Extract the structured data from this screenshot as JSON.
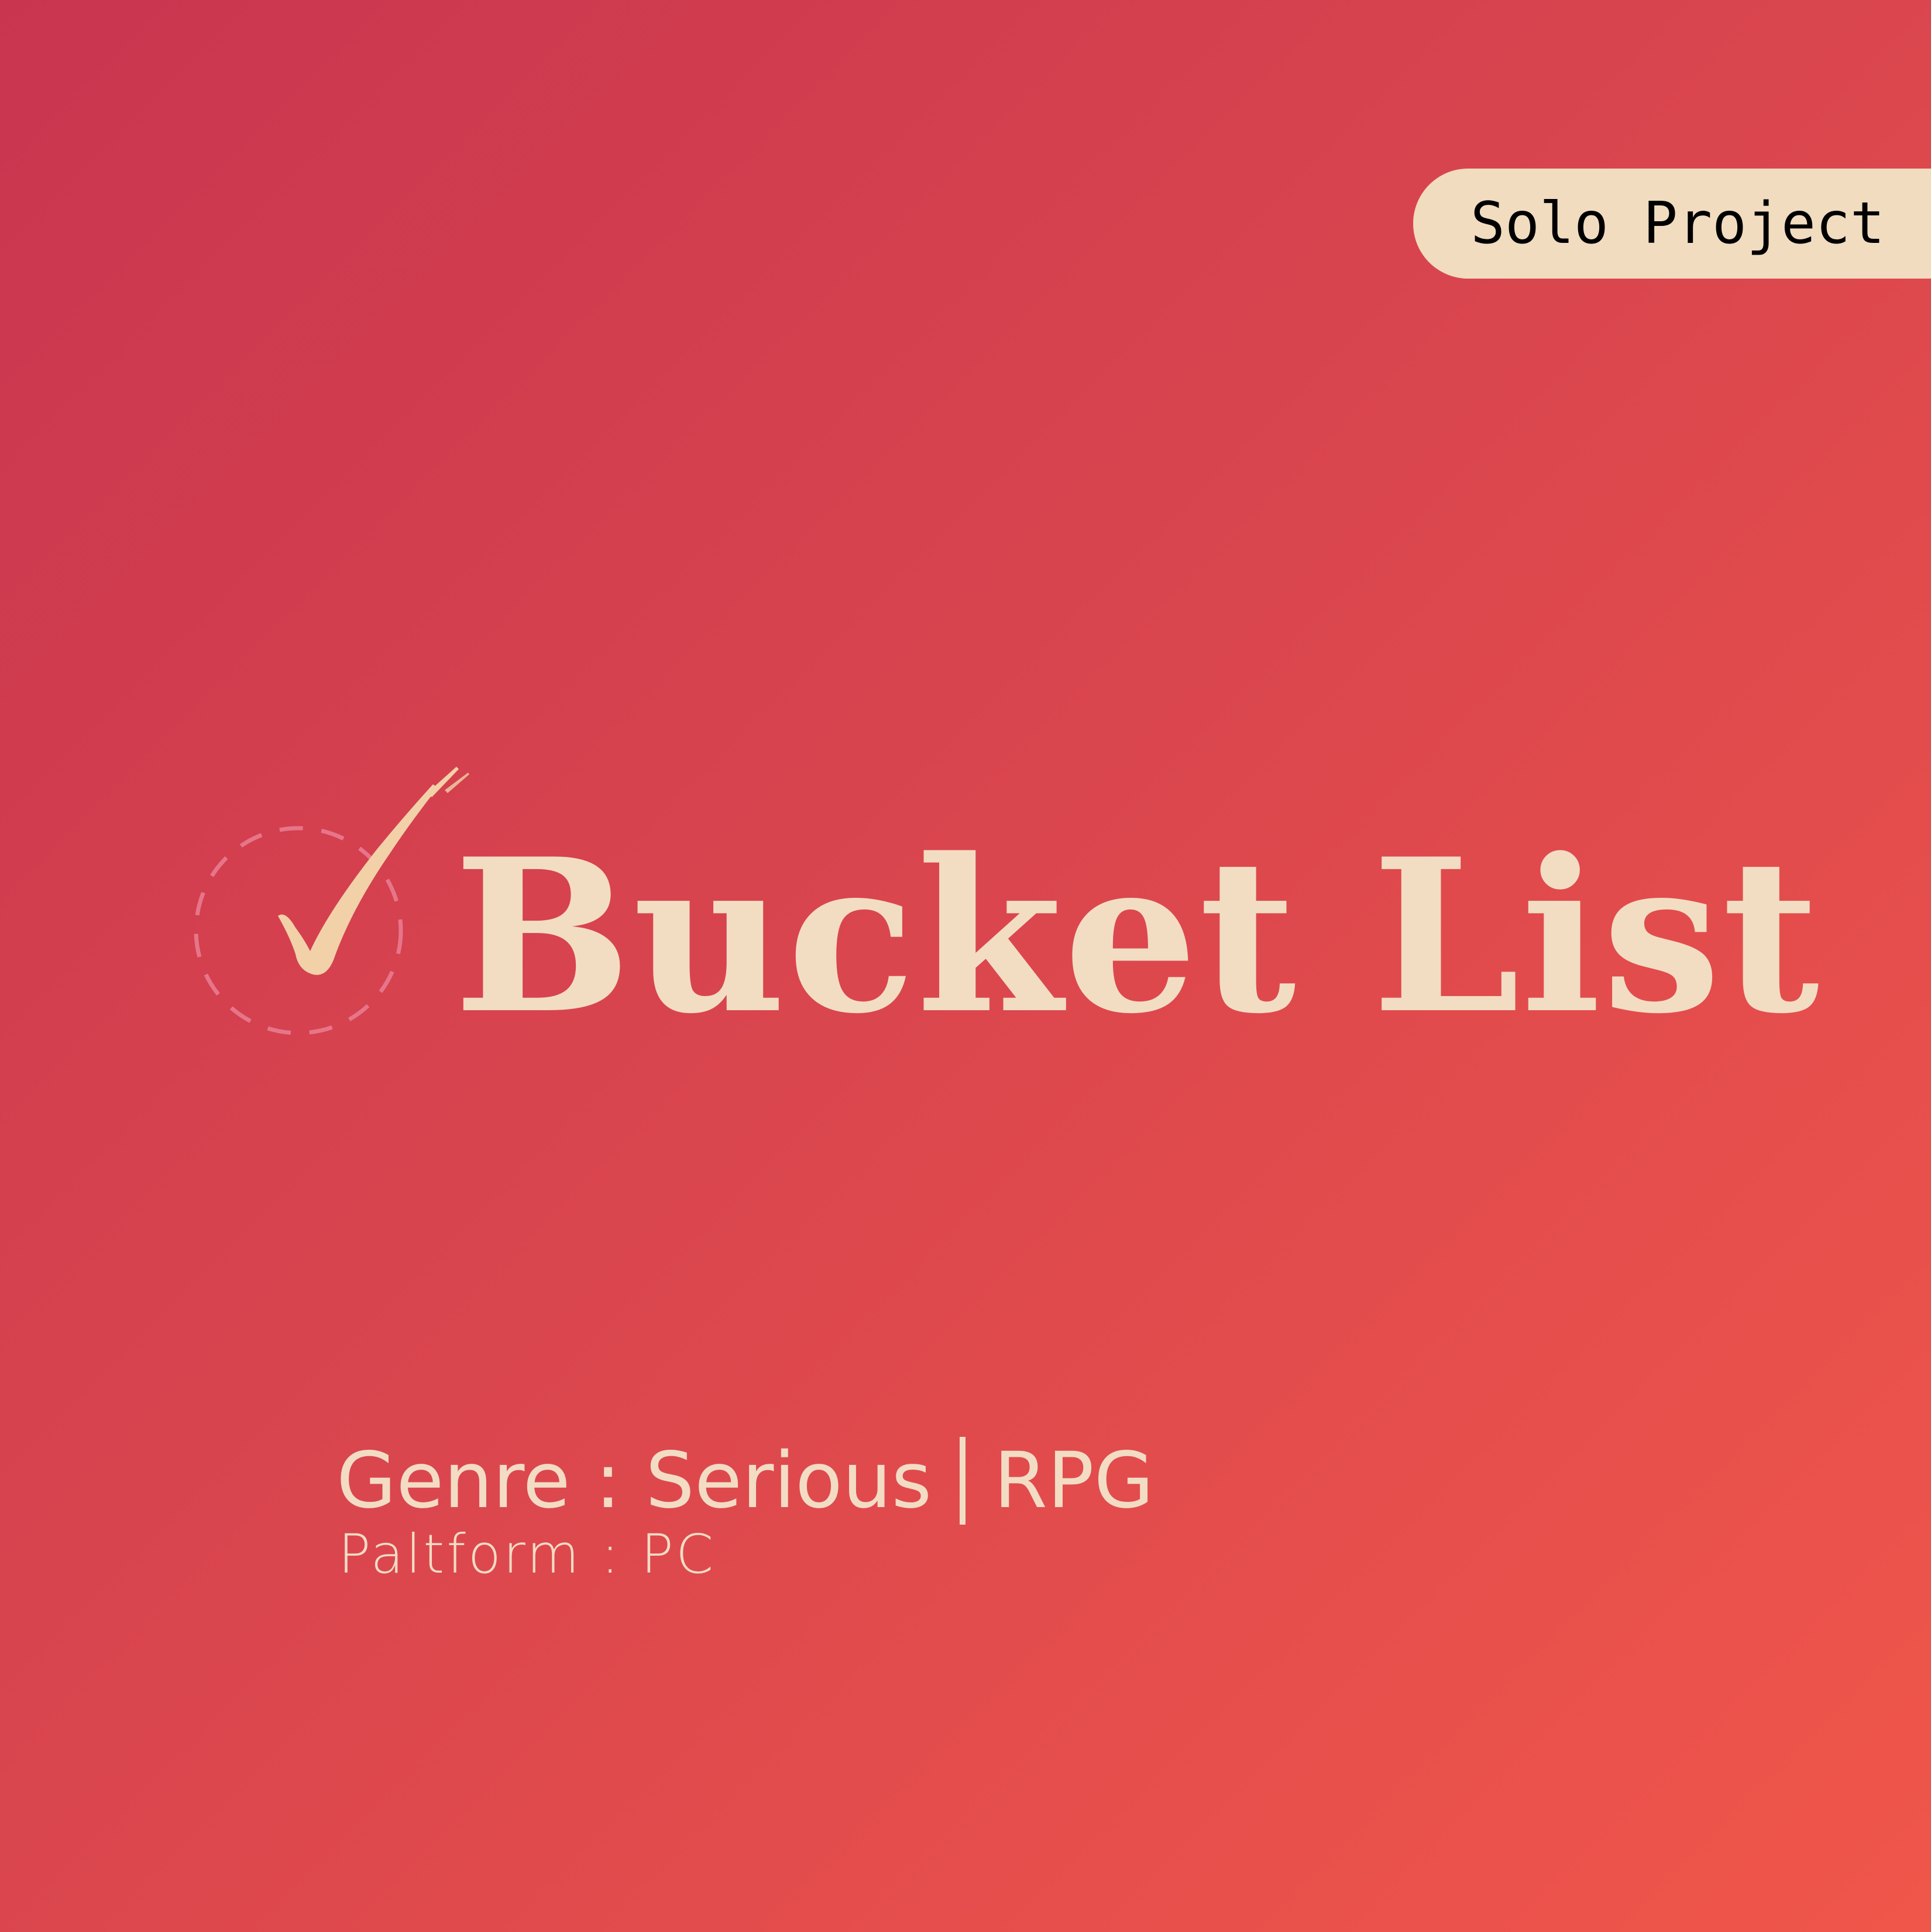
{
  "badge": {
    "label": "Solo Project"
  },
  "logo": {
    "icon": "checkmark-in-dashed-circle-icon",
    "check_color": "#f2d1a8",
    "circle_color": "#e7758a"
  },
  "title": {
    "text": "Bucket List"
  },
  "details": {
    "genre_prefix": "Genre : Serious",
    "genre_suffix": "RPG",
    "platform": "Paltform : PC"
  },
  "colors": {
    "background_start": "#c9354f",
    "background_end": "#f0564a",
    "cream": "#f2ddc3"
  }
}
